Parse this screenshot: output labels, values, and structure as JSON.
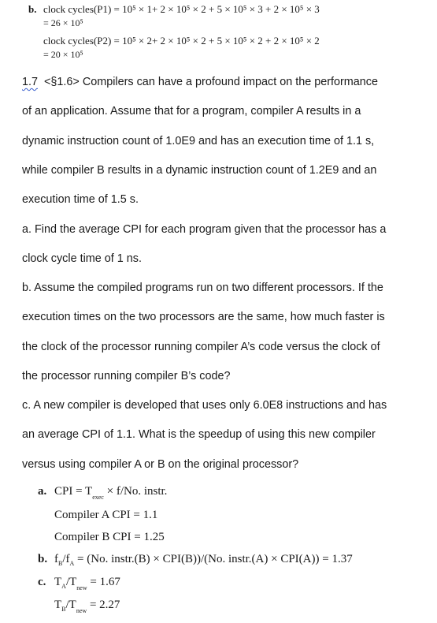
{
  "part1": {
    "label": "b.",
    "p1_line1": "clock cycles(P1) = 10⁵ × 1+ 2 × 10⁵ × 2 + 5 × 10⁵ × 3 + 2 × 10⁵ × 3",
    "p1_line2": "= 26 × 10⁵",
    "p2_line1": "clock cycles(P2) = 10⁵ × 2+ 2 × 10⁵ × 2 + 5 × 10⁵ × 2 + 2 × 10⁵ × 2",
    "p2_line2": "= 20 × 10⁵"
  },
  "problem": {
    "number": "1.7",
    "section_ref": "<§1.6>",
    "lines": [
      "Compilers can have a profound impact on the performance",
      "of an application. Assume that for a program, compiler A results in a",
      "dynamic instruction count of 1.0E9 and has an execution time of 1.1 s,",
      "while compiler B results in a dynamic instruction count of 1.2E9 and an",
      "execution time of 1.5 s.",
      "a. Find the average CPI for each program given that the processor has a",
      "clock cycle time of 1 ns.",
      "b. Assume the compiled programs run on two different processors. If the",
      "execution times on the two processors are the same, how much faster is",
      "the clock of the processor running compiler A’s code versus the clock of",
      "the processor running compiler B’s code?",
      "c. A new compiler is developed that uses only 6.0E8 instructions and has",
      "an average CPI of 1.1. What is the speedup of using this new compiler",
      "versus using compiler A or B on the original processor?"
    ]
  },
  "answers": {
    "a_label": "a.",
    "a_cpi_pre": "CPI = T",
    "a_cpi_sub": "exec",
    "a_cpi_post": " × f/No. instr.",
    "a_compA": "Compiler A CPI = 1.1",
    "a_compB": "Compiler B CPI = 1.25",
    "b_label": "b.",
    "b_f": "f",
    "b_sub_b": "B",
    "b_slash": "/f",
    "b_sub_a": "A",
    "b_rest": " = (No. instr.(B) × CPI(B))/(No. instr.(A) × CPI(A)) = 1.37",
    "c_label": "c.",
    "c1_t": "T",
    "c1_sub_a": "A",
    "c1_slash": "/T",
    "c1_sub_new": "new",
    "c1_val": " = 1.67",
    "c2_t": "T",
    "c2_sub_b": "B",
    "c2_slash": "/T",
    "c2_sub_new": "new",
    "c2_val": " = 2.27"
  }
}
